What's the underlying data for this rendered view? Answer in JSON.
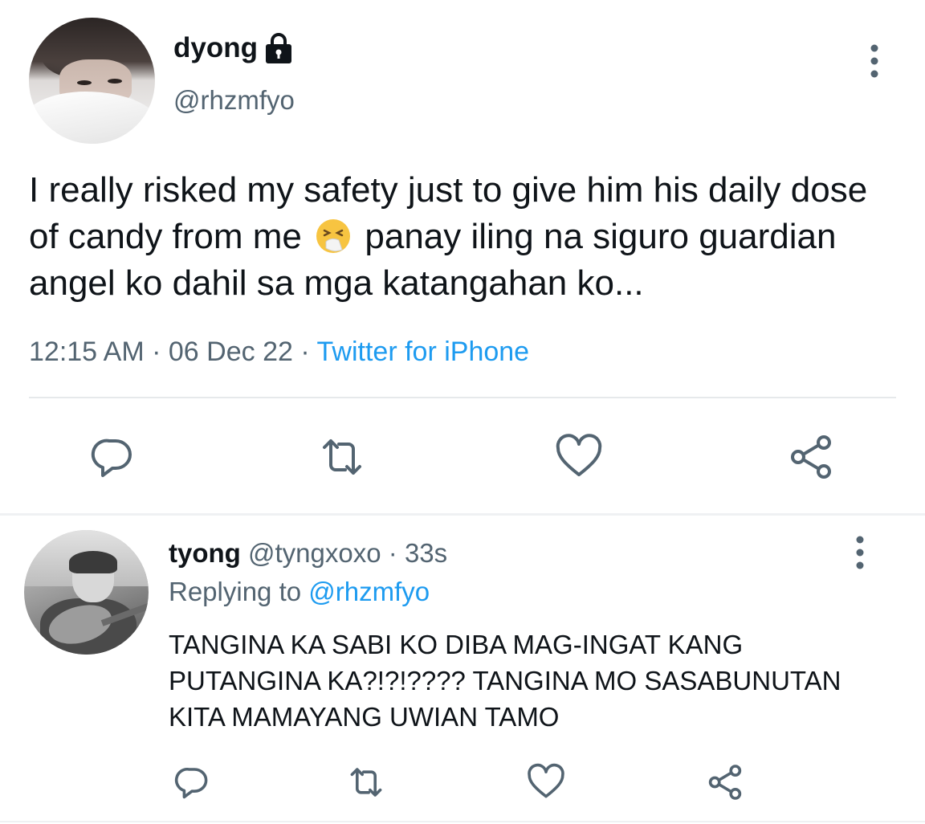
{
  "main_tweet": {
    "display_name": "dyong",
    "handle": "@rhzmfyo",
    "text_before_emoji": "I really risked my safety just to give him his daily dose of candy from me",
    "emoji": "sneezing-face-emoji",
    "text_after_emoji": "panay iling na siguro guardian angel ko dahil sa mga katangahan ko...",
    "time": "12:15 AM",
    "date": "06 Dec 22",
    "separator": "·",
    "source": "Twitter for iPhone",
    "protected": true
  },
  "reply_tweet": {
    "display_name": "tyong",
    "handle": "@tyngxoxo",
    "separator": "·",
    "time_ago": "33s",
    "replying_to_label": "Replying to",
    "replying_to_handle": "@rhzmfyo",
    "text": "TANGINA KA SABI KO DIBA MAG-INGAT KANG PUTANGINA KA?!?!???? TANGINA MO SASABUNUTAN KITA MAMAYANG UWIAN TAMO"
  },
  "icons": {
    "reply": "reply-icon",
    "retweet": "retweet-icon",
    "like": "heart-icon",
    "share": "share-icon",
    "more": "more-vertical-icon",
    "lock": "lock-icon"
  },
  "colors": {
    "text": "#0f1419",
    "secondary": "#536471",
    "link": "#1d9bf0",
    "divider": "#e6e9eb"
  }
}
